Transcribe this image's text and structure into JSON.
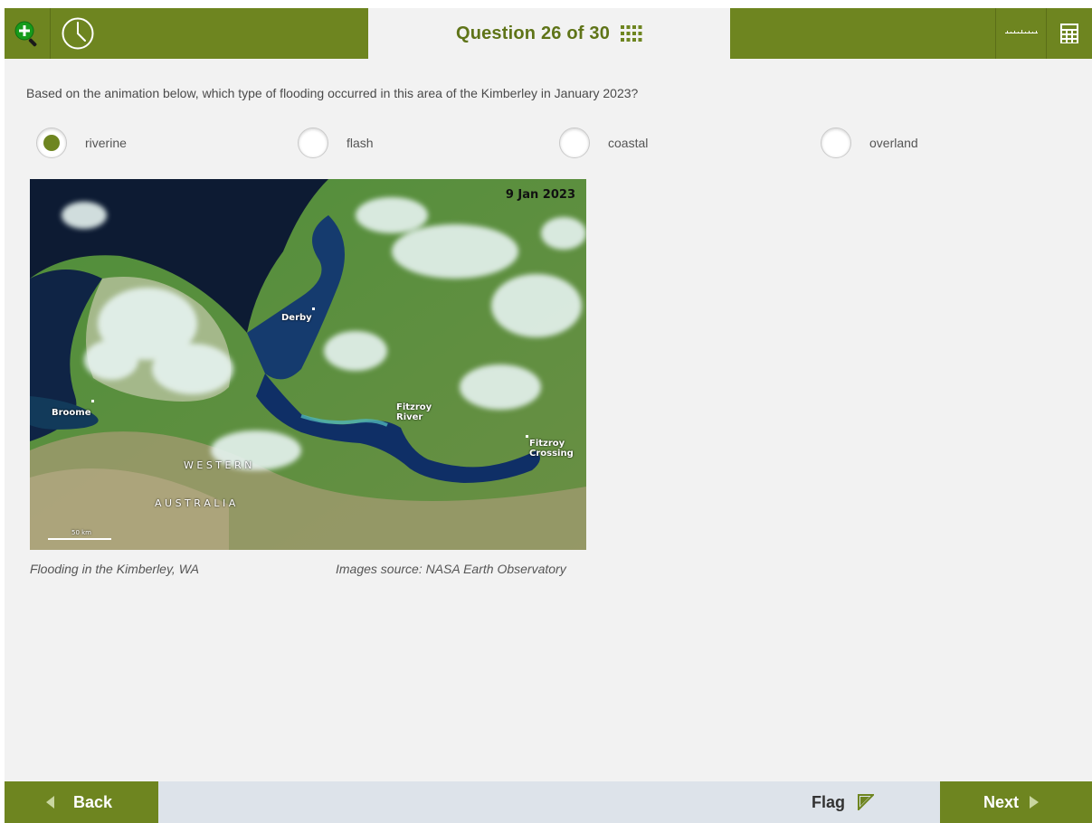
{
  "header": {
    "title": "Question 26 of 30",
    "icons": [
      "zoom-in-icon",
      "clock-icon",
      "grid-icon",
      "line-reader-icon",
      "calculator-icon"
    ]
  },
  "question": {
    "text": "Based on the animation below, which type of flooding occurred in this area of the Kimberley in January 2023?",
    "options": [
      {
        "label": "riverine",
        "selected": true
      },
      {
        "label": "flash",
        "selected": false
      },
      {
        "label": "coastal",
        "selected": false
      },
      {
        "label": "overland",
        "selected": false
      }
    ]
  },
  "figure": {
    "date": "9 Jan 2023",
    "places": {
      "derby": "Derby",
      "broome": "Broome",
      "fitzroy_river": "Fitzroy River",
      "fitzroy_crossing": "Fitzroy Crossing",
      "western": "W E S T E R N",
      "australia": "A U S T R A L I A",
      "scale": "50 km"
    },
    "caption_left": "Flooding in the Kimberley, WA",
    "caption_right": "Images source: NASA Earth Observatory"
  },
  "footer": {
    "back_label": "Back",
    "flag_label": "Flag",
    "next_label": "Next"
  },
  "colors": {
    "accent": "#6e8520",
    "background": "#f2f2f2",
    "footer_bg": "#dde3ea"
  }
}
